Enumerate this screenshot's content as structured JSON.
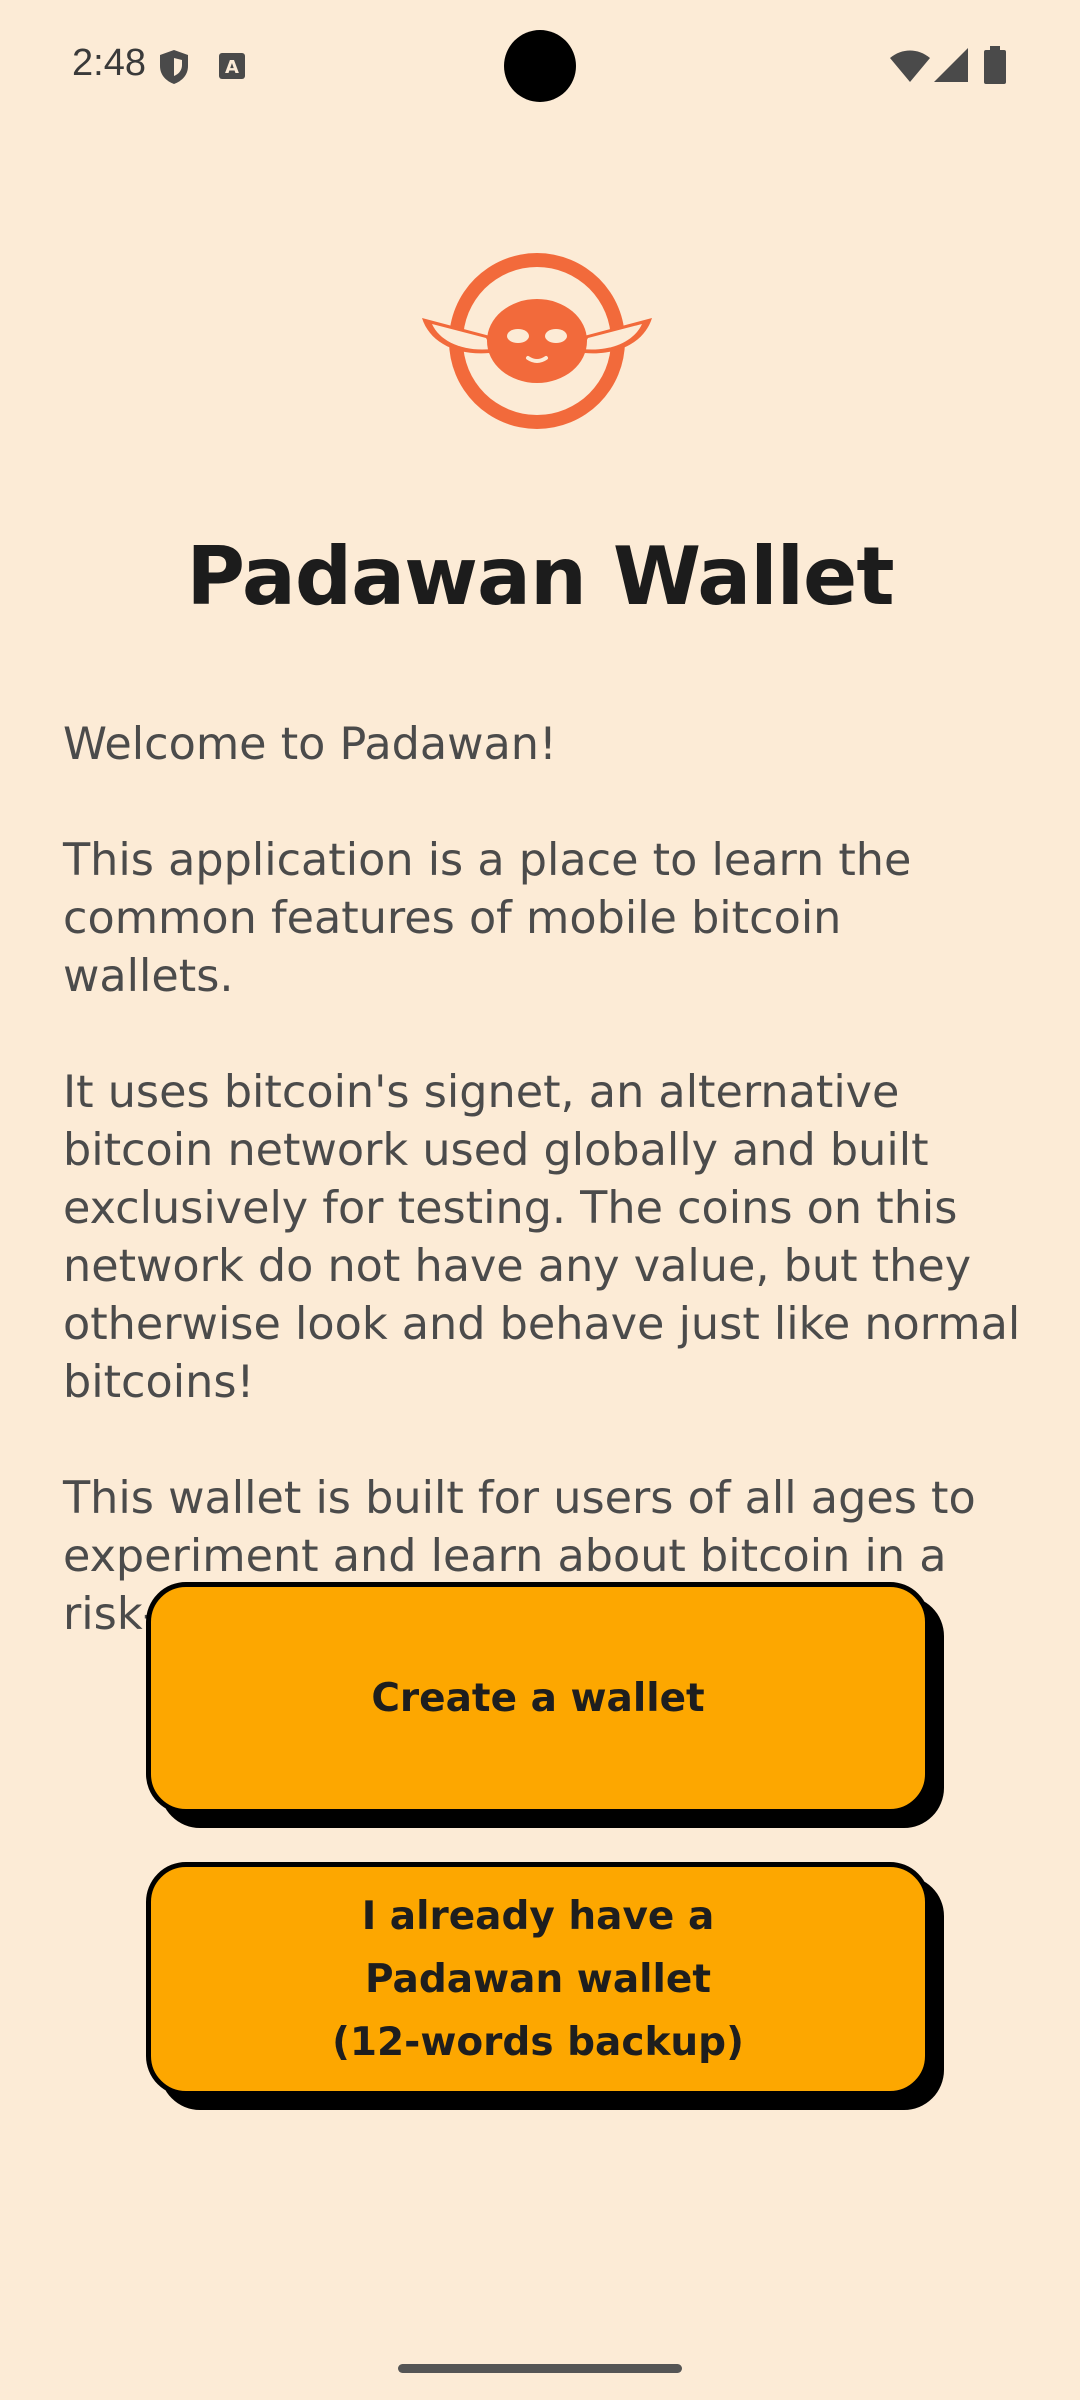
{
  "status_bar": {
    "time": "2:48",
    "icons": [
      "shield-icon",
      "text-a-icon",
      "wifi-icon",
      "signal-icon",
      "battery-icon"
    ]
  },
  "logo": {
    "icon": "padawan-logo-icon",
    "color": "#f26a3b"
  },
  "title": "Padawan Wallet",
  "intro": {
    "paragraphs": [
      "Welcome to Padawan!",
      "This application is a place to learn the common features of mobile bitcoin wallets.",
      "It uses bitcoin's signet, an alternative bitcoin network used globally and built exclusively for testing. The coins on this network do not have any value, but they otherwise look and behave just like normal bitcoins!",
      "This wallet is built for users of all ages to experiment and learn about bitcoin in a risk-free environment."
    ]
  },
  "buttons": {
    "create_wallet": "Create a wallet",
    "restore_line1": "I already have a",
    "restore_line2": "Padawan wallet",
    "restore_line3": "(12-words backup)"
  },
  "colors": {
    "background": "#fcebd6",
    "button": "#fda700",
    "accent": "#f26a3b"
  }
}
